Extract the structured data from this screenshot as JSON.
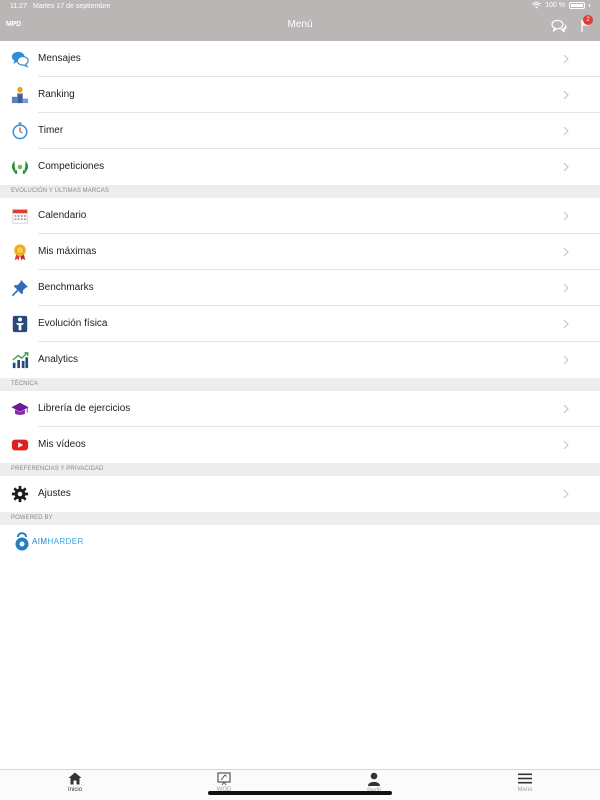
{
  "status_bar": {
    "time": "11:27",
    "date": "Martes 17 de septiembre",
    "battery": "100 %"
  },
  "navbar": {
    "logo": "MPD",
    "title": "Menú",
    "notification_count": "2"
  },
  "menu": {
    "main": [
      {
        "label": "Mensajes",
        "icon": "chat-bubbles-icon"
      },
      {
        "label": "Ranking",
        "icon": "podium-icon"
      },
      {
        "label": "Timer",
        "icon": "stopwatch-icon"
      },
      {
        "label": "Competiciones",
        "icon": "laurel-icon"
      }
    ],
    "section_evolution": "Evolución y últimas marcas",
    "evolution": [
      {
        "label": "Calendario",
        "icon": "calendar-icon"
      },
      {
        "label": "Mis máximas",
        "icon": "medal-icon"
      },
      {
        "label": "Benchmarks",
        "icon": "pin-icon"
      },
      {
        "label": "Evolución física",
        "icon": "body-icon"
      },
      {
        "label": "Analytics",
        "icon": "chart-icon"
      }
    ],
    "section_technique": "Técnica",
    "technique": [
      {
        "label": "Librería de ejercicios",
        "icon": "graduation-cap-icon"
      },
      {
        "label": "Mis vídeos",
        "icon": "video-play-icon"
      }
    ],
    "section_preferences": "Preferencias y privacidad",
    "preferences": [
      {
        "label": "Ajustes",
        "icon": "gear-icon"
      }
    ],
    "section_powered": "Powered by",
    "powered_brand_a": "AIM",
    "powered_brand_b": "HARDER"
  },
  "tabbar": {
    "tabs": [
      {
        "label": "Inicio",
        "icon": "home-icon"
      },
      {
        "label": "WOD",
        "icon": "whiteboard-icon"
      },
      {
        "label": "Perfil",
        "icon": "user-icon"
      },
      {
        "label": "Menú",
        "icon": "hamburger-icon"
      }
    ]
  },
  "colors": {
    "navbar_bg": "#b9b6b5",
    "section_bg": "#ededed",
    "badge": "#e53935",
    "brand_blue": "#1f7fc4"
  }
}
